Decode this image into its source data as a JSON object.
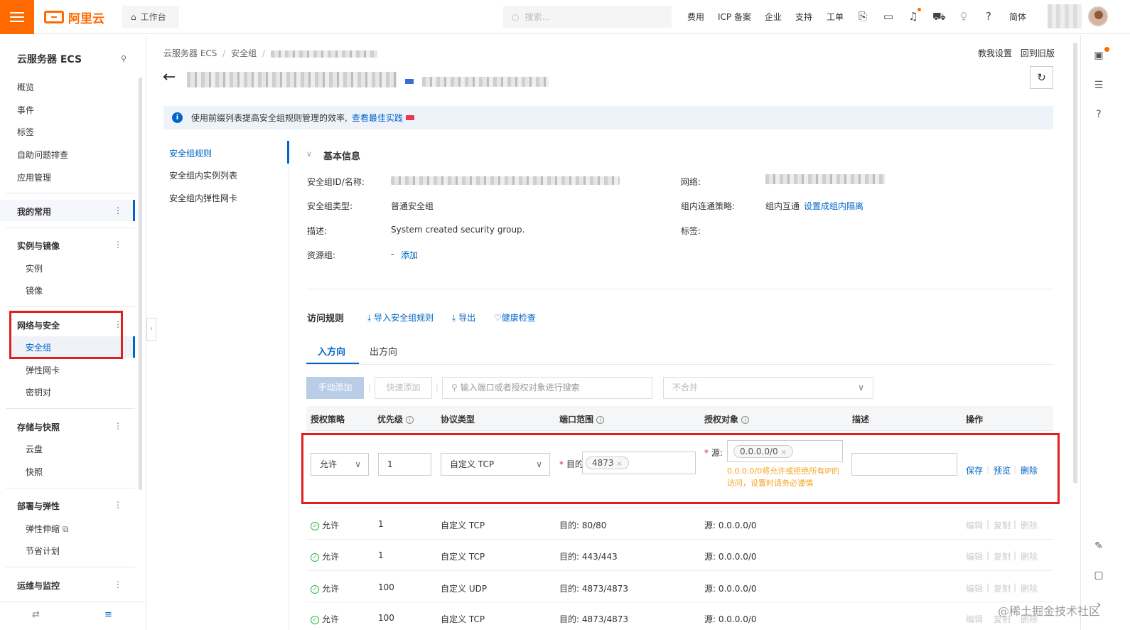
{
  "topbar": {
    "logo_text": "阿里云",
    "workbench": "工作台",
    "search_placeholder": "搜索...",
    "nav": [
      "费用",
      "ICP 备案",
      "企业",
      "支持",
      "工单"
    ],
    "lang": "简体",
    "brand_color": "#ff6a00"
  },
  "sidebar": {
    "title": "云服务器 ECS",
    "top_items": [
      "概览",
      "事件",
      "标签",
      "自助问题排查",
      "应用管理"
    ],
    "favorites": "我的常用",
    "groups": [
      {
        "label": "实例与镜像",
        "items": [
          "实例",
          "镜像"
        ]
      },
      {
        "label": "网络与安全",
        "items": [
          "安全组",
          "弹性网卡",
          "密钥对"
        ]
      },
      {
        "label": "存储与快照",
        "items": [
          "云盘",
          "快照"
        ]
      },
      {
        "label": "部署与弹性",
        "items": [
          "弹性伸缩",
          "节省计划"
        ]
      },
      {
        "label": "运维与监控",
        "items": []
      }
    ],
    "dots": "⋮"
  },
  "breadcrumb": {
    "items": [
      "云服务器 ECS",
      "安全组"
    ],
    "sep": "/"
  },
  "header_links": {
    "guide": "教我设置",
    "old": "回到旧版"
  },
  "info_bar": {
    "text": "使用前缀列表提高安全组规则管理的效率,",
    "link": "查看最佳实践"
  },
  "subnav": [
    "安全组规则",
    "安全组内实例列表",
    "安全组内弹性网卡"
  ],
  "basic": {
    "title": "基本信息",
    "labels": {
      "id_name": "安全组ID/名称:",
      "type": "安全组类型:",
      "desc": "描述:",
      "rg": "资源组:",
      "network": "网络:",
      "policy": "组内连通策略:",
      "tags": "标签:"
    },
    "values": {
      "type": "普通安全组",
      "desc": "System created security group.",
      "rg_dash": "-",
      "rg_add": "添加",
      "policy": "组内互通",
      "policy_link": "设置成组内隔离"
    }
  },
  "rules": {
    "title": "访问规则",
    "actions": [
      "导入安全组规则",
      "导出",
      "健康检查"
    ],
    "tabs": [
      "入方向",
      "出方向"
    ],
    "btn_manual": "手动添加",
    "btn_quick": "快速添加",
    "search_placeholder": "输入端口或者授权对象进行搜索",
    "merge_select": "不合并",
    "headers": [
      "授权策略",
      "优先级",
      "协议类型",
      "端口范围",
      "授权对象",
      "描述",
      "操作"
    ]
  },
  "edit_row": {
    "policy": "允许",
    "priority": "1",
    "protocol": "自定义 TCP",
    "dest_label": "目的",
    "port_tag": "4873",
    "source_label": "源:",
    "source_tag": "0.0.0.0/0",
    "warning": "0.0.0.0/0将允许或拒绝所有IP的访问，设置时请务必谨慎",
    "ops": [
      "保存",
      "预览",
      "删除"
    ]
  },
  "rows": [
    {
      "policy": "允许",
      "priority": "1",
      "protocol": "自定义 TCP",
      "port": "目的: 80/80",
      "source": "源: 0.0.0.0/0"
    },
    {
      "policy": "允许",
      "priority": "1",
      "protocol": "自定义 TCP",
      "port": "目的: 443/443",
      "source": "源: 0.0.0.0/0"
    },
    {
      "policy": "允许",
      "priority": "100",
      "protocol": "自定义 UDP",
      "port": "目的: 4873/4873",
      "source": "源: 0.0.0.0/0"
    },
    {
      "policy": "允许",
      "priority": "100",
      "protocol": "自定义 TCP",
      "port": "目的: 4873/4873",
      "source": "源: 0.0.0.0/0"
    }
  ],
  "row_ops": [
    "编辑",
    "复制",
    "删除"
  ],
  "watermark": "@稀土掘金技术社区"
}
